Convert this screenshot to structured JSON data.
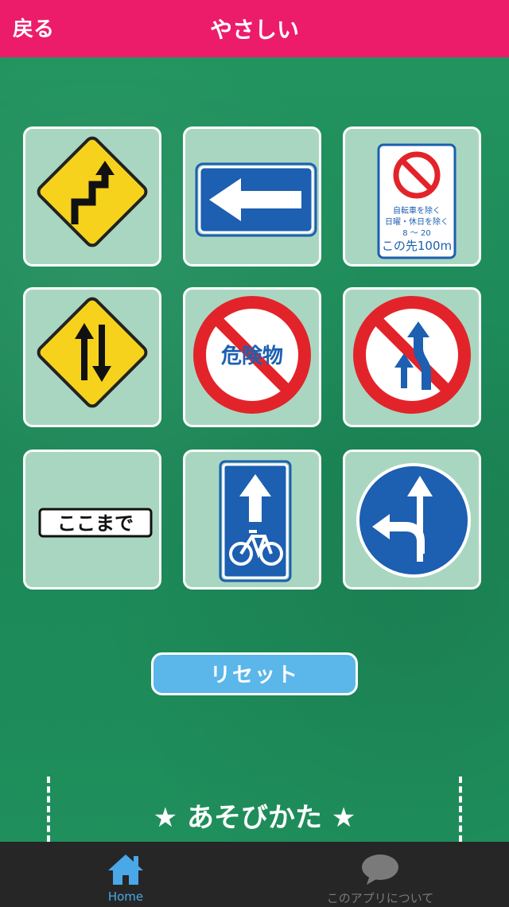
{
  "header": {
    "back_label": "戻る",
    "title": "やさしい"
  },
  "tiles": [
    {
      "name": "winding-road-sign"
    },
    {
      "name": "one-way-sign"
    },
    {
      "name": "no-bicycle-parking-sign",
      "text": [
        "自転車を除く",
        "日曜・休日を除く",
        "8 ～ 20",
        "この先100m"
      ]
    },
    {
      "name": "two-way-traffic-sign"
    },
    {
      "name": "no-hazardous-materials-sign",
      "text": "危険物"
    },
    {
      "name": "no-overtaking-sign"
    },
    {
      "name": "end-of-zone-sign",
      "text": "ここまで"
    },
    {
      "name": "bicycle-lane-sign"
    },
    {
      "name": "straight-or-left-turn-sign"
    }
  ],
  "reset_label": "リセット",
  "howto_title": "★ あそびかた ★",
  "tabs": [
    {
      "label": "Home",
      "icon": "home-icon",
      "active": true
    },
    {
      "label": "このアプリについて",
      "icon": "speech-bubble-icon",
      "active": false
    }
  ],
  "colors": {
    "header": "#ec1c6b",
    "board": "#1e8a5a",
    "tile": "#a9d6c1",
    "reset": "#5bb6ea",
    "tab_active": "#4aa8e8",
    "tab_inactive": "#7a7a7a"
  }
}
